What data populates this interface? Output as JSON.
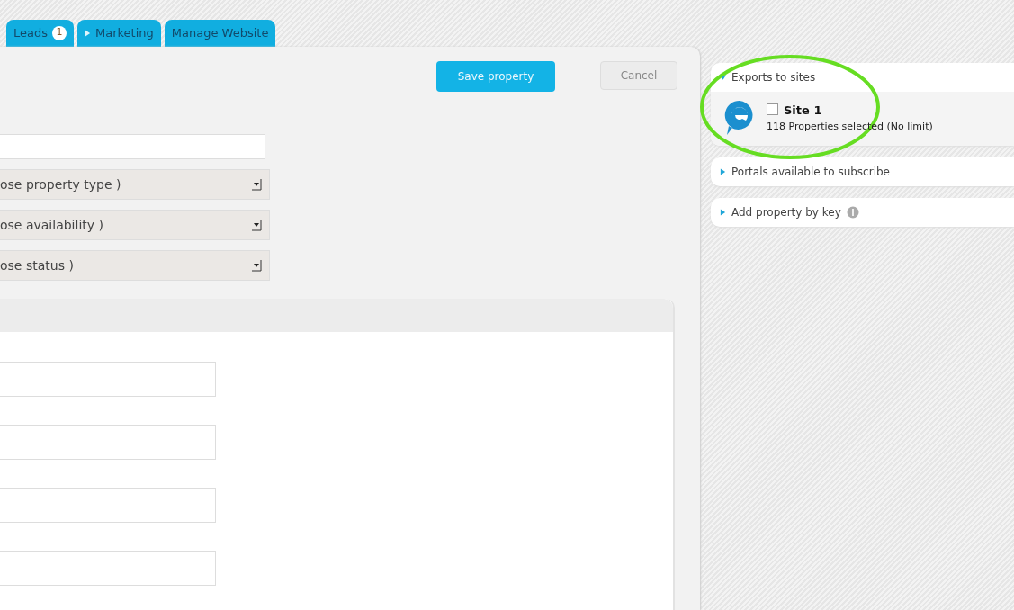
{
  "tabs": [
    {
      "label": "Leads",
      "badge": "1",
      "kind": "plain",
      "selected": false
    },
    {
      "label": "Marketing",
      "kind": "submenu",
      "selected": false
    },
    {
      "label": "Manage Website",
      "kind": "plain",
      "selected": false
    }
  ],
  "actions": {
    "save": "Save property",
    "cancel": "Cancel"
  },
  "form": {
    "text_field": {
      "kind": "text"
    },
    "selects": [
      {
        "value": "ose property type )"
      },
      {
        "value": "ose availability )"
      },
      {
        "value": "ose status )"
      }
    ],
    "section_fields": [
      {
        "kind": "text"
      },
      {
        "kind": "text"
      },
      {
        "kind": "text"
      },
      {
        "kind": "text"
      }
    ]
  },
  "sidebar": [
    {
      "title": "Exports to sites",
      "expanded": true,
      "info": false,
      "sites": [
        {
          "name": "Site 1",
          "detail": "118 Properties selected (No limit)",
          "checked": false
        }
      ]
    },
    {
      "title": "Portals available to subscribe",
      "expanded": false,
      "info": false
    },
    {
      "title": "Add property by key",
      "expanded": false,
      "info": true
    }
  ],
  "annotation": {
    "kind": "ellipse",
    "color": "#66dd22"
  }
}
